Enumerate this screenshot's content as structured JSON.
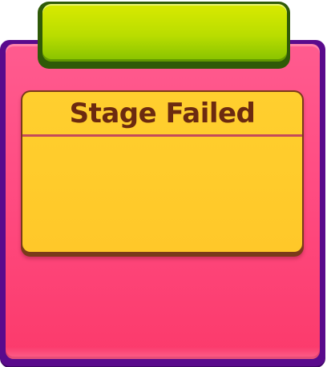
{
  "dialog": {
    "title": "Stage Failed",
    "colors": {
      "frame": "#5a0a8c",
      "panel": "#ff4c82",
      "header_bar": "#b9dd00",
      "content_box": "#ffc829",
      "title_text": "#6b2a10"
    }
  }
}
